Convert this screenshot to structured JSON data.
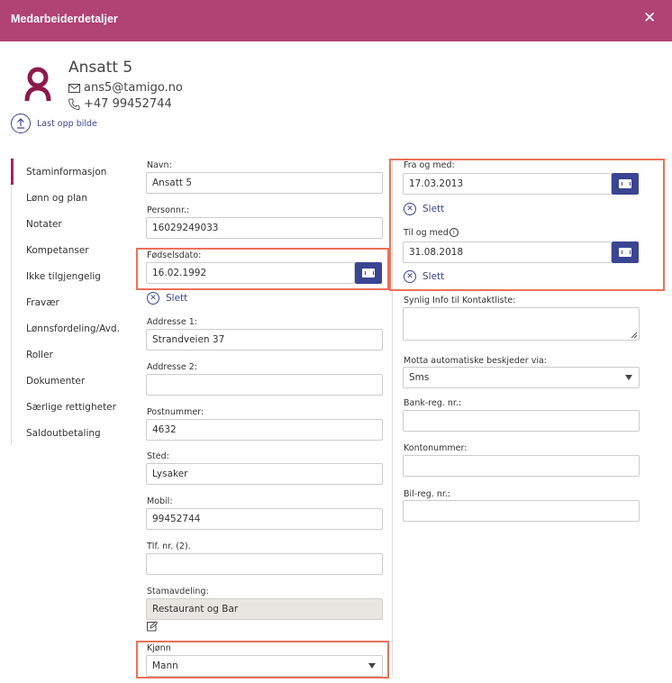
{
  "header": {
    "title": "Medarbeiderdetaljer"
  },
  "employee": {
    "name": "Ansatt 5",
    "email": "ans5@tamigo.no",
    "phone": "+47 99452744",
    "upload_label": "Last opp bilde"
  },
  "sidebar": {
    "items": [
      {
        "label": "Staminformasjon",
        "active": true
      },
      {
        "label": "Lønn og plan"
      },
      {
        "label": "Notater"
      },
      {
        "label": "Kompetanser"
      },
      {
        "label": "Ikke tilgjengelig"
      },
      {
        "label": "Fravær"
      },
      {
        "label": "Lønnsfordeling/Avd."
      },
      {
        "label": "Roller"
      },
      {
        "label": "Dokumenter"
      },
      {
        "label": "Særlige rettigheter"
      },
      {
        "label": "Saldoutbetaling"
      }
    ]
  },
  "form": {
    "navn": {
      "label": "Navn:",
      "value": "Ansatt 5"
    },
    "personnr": {
      "label": "Personnr.:",
      "value": "16029249033"
    },
    "fodselsdato": {
      "label": "Fødselsdato:",
      "value": "16.02.1992"
    },
    "delete_label": "Slett",
    "adresse1": {
      "label": "Addresse 1:",
      "value": "Strandveien 37"
    },
    "adresse2": {
      "label": "Addresse 2:",
      "value": ""
    },
    "postnummer": {
      "label": "Postnummer:",
      "value": "4632"
    },
    "sted": {
      "label": "Sted:",
      "value": "Lysaker"
    },
    "mobil": {
      "label": "Mobil:",
      "value": "99452744"
    },
    "tlf2": {
      "label": "Tlf. nr. (2).",
      "value": ""
    },
    "stamavdeling": {
      "label": "Stamavdeling:",
      "value": "Restaurant og Bar"
    },
    "kjonn": {
      "label": "Kjønn",
      "value": "Mann"
    },
    "fra_og_med": {
      "label": "Fra og med:",
      "value": "17.03.2013"
    },
    "til_og_med": {
      "label": "Til og med",
      "value": "31.08.2018"
    },
    "synlig_info": {
      "label": "Synlig Info til Kontaktliste:",
      "value": ""
    },
    "motta": {
      "label": "Motta automatiske beskjeder via:",
      "value": "Sms"
    },
    "bank_reg": {
      "label": "Bank-reg. nr.:",
      "value": ""
    },
    "kontonummer": {
      "label": "Kontonummer:",
      "value": ""
    },
    "bil_reg": {
      "label": "Bil-reg. nr.:",
      "value": ""
    }
  },
  "colors": {
    "header": "#b04274",
    "accent_blue": "#3a4593",
    "avatar": "#8b1a4a",
    "highlight": "#ec7058",
    "active_tab": "#9d2a5c"
  }
}
